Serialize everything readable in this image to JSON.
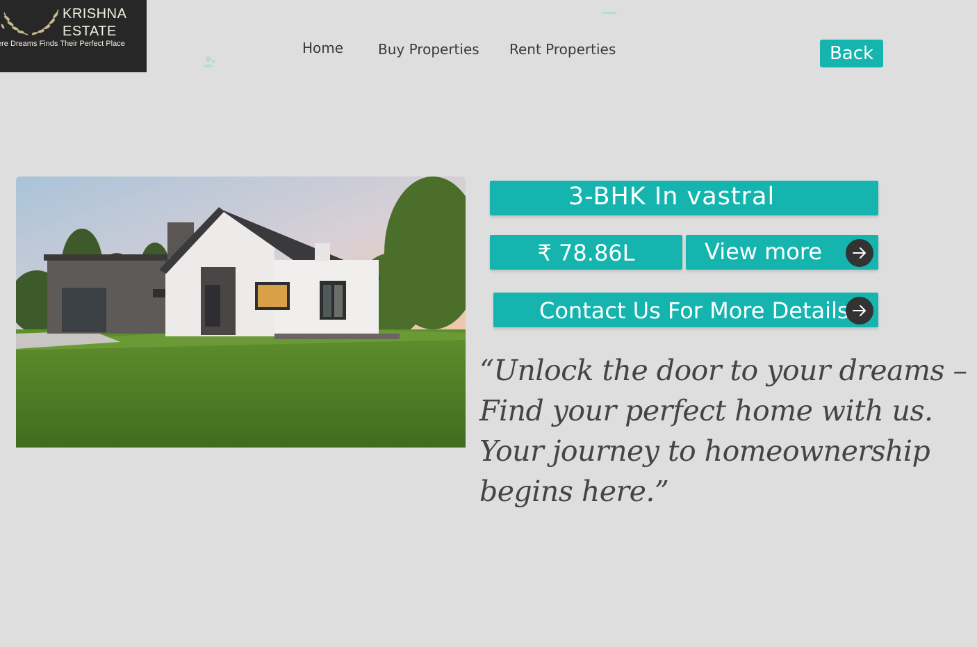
{
  "brand": {
    "name_line1": "KRISHNA",
    "name_line2": "ESTATE",
    "tagline": "ere Dreams Finds Their Perfect Place"
  },
  "nav": {
    "items": [
      {
        "label": "Home"
      },
      {
        "label": "Buy Properties"
      },
      {
        "label": "Rent Properties"
      }
    ],
    "back_label": "Back"
  },
  "property": {
    "title": "3-BHK In vastral",
    "price": "₹ 78.86L",
    "view_more_label": "View more",
    "contact_label": "Contact Us For More Details"
  },
  "quote": "“Unlock the door to your dreams – Find your perfect home with us. Your journey to homeownership begins here.”",
  "colors": {
    "accent": "#15b4ae",
    "background": "#dedede",
    "logo_bg": "#272727",
    "arrow_circle": "#333333"
  },
  "icons": {
    "arrow": "arrow-right-icon",
    "decor": "person-icon"
  }
}
